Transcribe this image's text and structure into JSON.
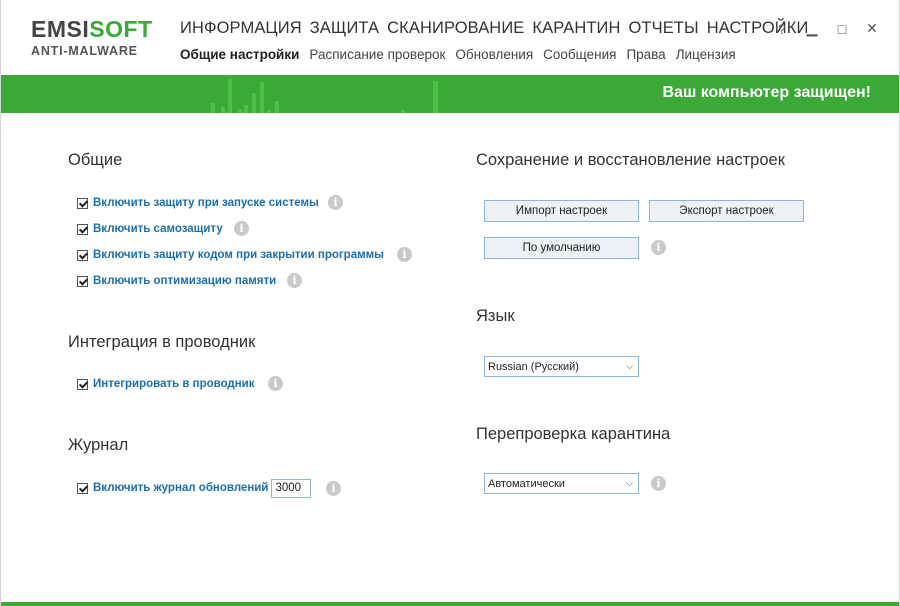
{
  "logo": {
    "brand_a": "EMSI",
    "brand_b": "SOFT",
    "product": "ANTI-MALWARE"
  },
  "main_nav": [
    "ИНФОРМАЦИЯ",
    "ЗАЩИТА",
    "СКАНИРОВАНИЕ",
    "КАРАНТИН",
    "ОТЧЕТЫ",
    "НАСТРОЙКИ"
  ],
  "sub_nav": [
    "Общие настройки",
    "Расписание проверок",
    "Обновления",
    "Сообщения",
    "Права",
    "Лицензия"
  ],
  "window_controls": {
    "help": "?",
    "minimize": "▁",
    "maximize": "□",
    "close": "✕"
  },
  "status": {
    "text": "Ваш компьютер защищен!",
    "color": "#3aa935"
  },
  "general": {
    "title": "Общие",
    "options": [
      "Включить защиту при запуске системы",
      "Включить самозащиту",
      "Включить защиту кодом при закрытии программы",
      "Включить оптимизацию памяти"
    ]
  },
  "explorer": {
    "title": "Интеграция в проводник",
    "option": "Интегрировать в проводник"
  },
  "journal": {
    "title": "Журнал",
    "option": "Включить журнал обновлений",
    "value": "3000"
  },
  "backup": {
    "title": "Сохранение и восстановление настроек",
    "import": "Импорт настроек",
    "export": "Экспорт настроек",
    "default": "По умолчанию"
  },
  "language": {
    "title": "Язык",
    "selected": "Russian (Русский)"
  },
  "quarantine": {
    "title": "Перепроверка карантина",
    "selected": "Автоматически"
  },
  "icons": {
    "info": "i",
    "chevron": "⌵"
  }
}
